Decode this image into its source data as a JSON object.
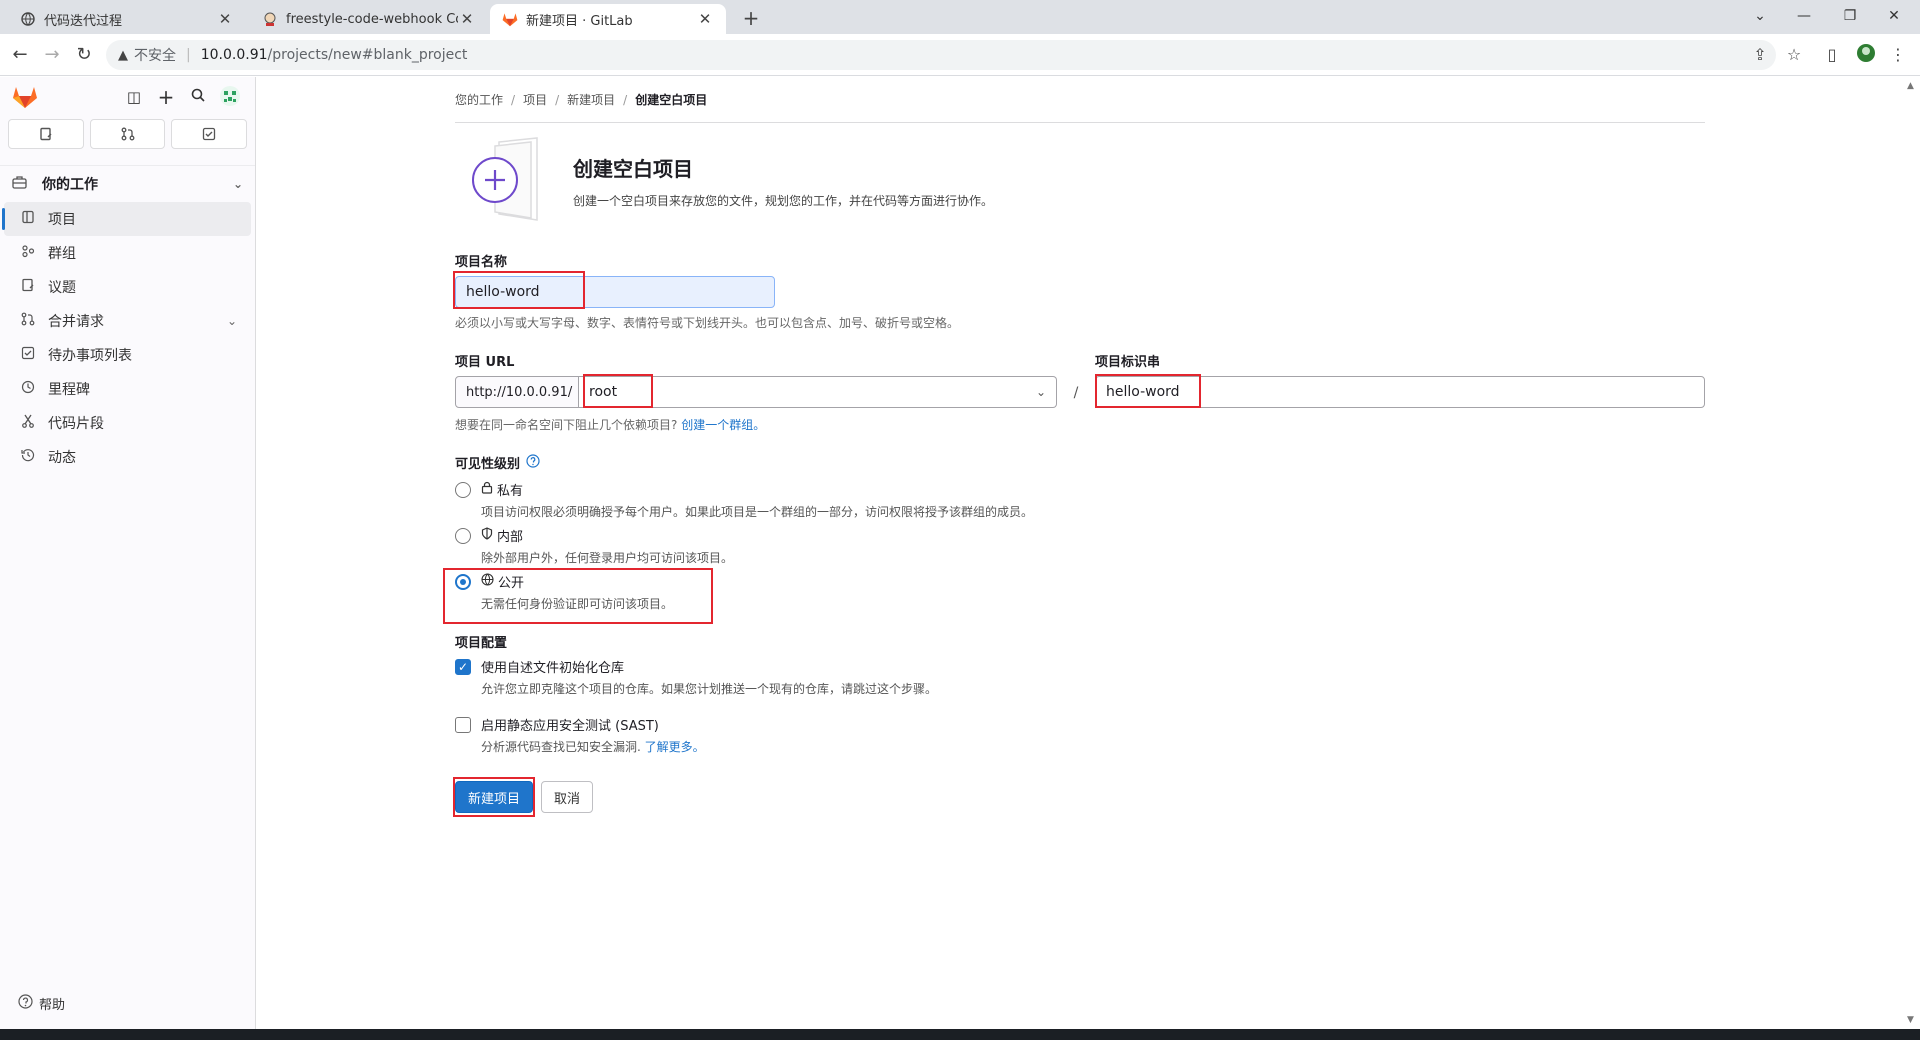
{
  "browser": {
    "tabs": [
      {
        "title": "代码迭代过程",
        "active": false
      },
      {
        "title": "freestyle-code-webhook Confi",
        "active": false
      },
      {
        "title": "新建项目 · GitLab",
        "active": true
      }
    ],
    "security_label": "不安全",
    "url_host": "10.0.0.91",
    "url_path": "/projects/new#blank_project"
  },
  "sidebar": {
    "section_title": "你的工作",
    "items": [
      {
        "label": "项目",
        "icon": "project-icon",
        "active": true
      },
      {
        "label": "群组",
        "icon": "group-icon"
      },
      {
        "label": "议题",
        "icon": "issues-icon"
      },
      {
        "label": "合并请求",
        "icon": "merge-request-icon",
        "has_chevron": true
      },
      {
        "label": "待办事项列表",
        "icon": "todo-icon"
      },
      {
        "label": "里程碑",
        "icon": "milestone-icon"
      },
      {
        "label": "代码片段",
        "icon": "snippet-icon"
      },
      {
        "label": "动态",
        "icon": "activity-icon"
      }
    ],
    "help_label": "帮助"
  },
  "breadcrumb": [
    "您的工作",
    "项目",
    "新建项目",
    "创建空白项目"
  ],
  "hero": {
    "title": "创建空白项目",
    "description": "创建一个空白项目来存放您的文件，规划您的工作，并在代码等方面进行协作。"
  },
  "form": {
    "project_name_label": "项目名称",
    "project_name_value": "hello-word",
    "project_name_help": "必须以小写或大写字母、数字、表情符号或下划线开头。也可以包含点、加号、破折号或空格。",
    "project_url_label": "项目 URL",
    "project_url_prefix": "http://10.0.0.91/",
    "namespace_value": "root",
    "slug_label": "项目标识串",
    "slug_value": "hello-word",
    "url_sep": "/",
    "group_help_prefix": "想要在同一命名空间下阻止几个依赖项目?",
    "group_help_link": "创建一个群组。",
    "visibility_label": "可见性级别",
    "visibility_options": [
      {
        "title": "私有",
        "icon": "lock-icon",
        "desc": "项目访问权限必须明确授予每个用户。如果此项目是一个群组的一部分，访问权限将授予该群组的成员。",
        "checked": false
      },
      {
        "title": "内部",
        "icon": "shield-icon",
        "desc": "除外部用户外，任何登录用户均可访问该项目。",
        "checked": false
      },
      {
        "title": "公开",
        "icon": "globe-icon",
        "desc": "无需任何身份验证即可访问该项目。",
        "checked": true
      }
    ],
    "config_label": "项目配置",
    "readme_title": "使用自述文件初始化仓库",
    "readme_desc": "允许您立即克隆这个项目的仓库。如果您计划推送一个现有的仓库，请跳过这个步骤。",
    "readme_checked": true,
    "sast_title": "启用静态应用安全测试 (SAST)",
    "sast_desc": "分析源代码查找已知安全漏洞.",
    "sast_link": "了解更多。",
    "sast_checked": false,
    "submit_label": "新建项目",
    "cancel_label": "取消"
  },
  "colors": {
    "accent": "#1f75cb",
    "highlight": "#e3262f",
    "gitlab_orange": "#fc6d26"
  }
}
